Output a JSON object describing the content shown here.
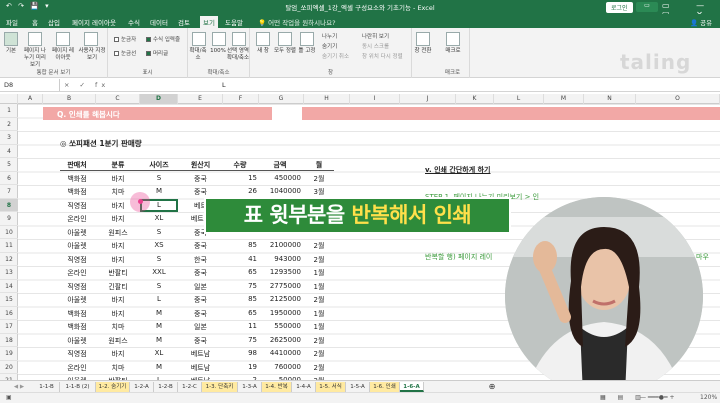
{
  "titlebar": {
    "quick_access": "↶ ↷ 💾 ▾",
    "title": "탈엄_쏘피엑셀_1강_엑셀 구성요소와 기초기능 - Excel",
    "login": "로그인",
    "window_controls": "▭ — ▢ ✕"
  },
  "ribbon_tabs": [
    "파일",
    "홈",
    "삽입",
    "페이지 레이아웃",
    "수식",
    "데이터",
    "검토",
    "보기",
    "도움말"
  ],
  "tell_me": "어떤 작업을 원하시나요?",
  "share": "공유",
  "ribbon": {
    "groups": {
      "workbook_views": "통합 문서 보기",
      "show": "표시",
      "zoom": "확대/축소",
      "window": "창",
      "macro": "매크로"
    },
    "normal": "기본",
    "page_break": "페이지 나누기 미리 보기",
    "page_layout": "페이지 레이아웃",
    "custom_views": "사용자 지정 보기",
    "ruler": "눈금자",
    "formula_bar": "수식 입력줄",
    "gridlines": "눈금선",
    "headings": "머리글",
    "zoom": "확대/축소",
    "zoom_100": "100%",
    "zoom_selection": "선택 영역 확대/축소",
    "new_window": "새 창",
    "arrange_all": "모두 정렬",
    "freeze_panes": "틀 고정",
    "split": "나누기",
    "hide": "숨기기",
    "unhide": "숨기기 취소",
    "side_by_side": "나란히 보기",
    "sync_scroll": "동시 스크롤",
    "reset_position": "창 위치 다시 정렬",
    "switch_windows": "창 전환",
    "macros": "매크로"
  },
  "brand_logo": "taling",
  "formula_bar": {
    "name_box": "D8",
    "fx": "× ✓ fx",
    "value": "L"
  },
  "columns": [
    "A",
    "B",
    "C",
    "D",
    "E",
    "F",
    "G",
    "H",
    "I",
    "J",
    "K",
    "L",
    "M",
    "N",
    "O"
  ],
  "rows": [
    "1",
    "2",
    "3",
    "4",
    "5",
    "6",
    "7",
    "8",
    "9",
    "10",
    "11",
    "12",
    "13",
    "14",
    "15",
    "16",
    "17",
    "18",
    "19",
    "20",
    "21"
  ],
  "banner_text": "Q. 인쇄를 해봅시다",
  "subtitle": "◎ 쏘피패션 1분기 판매량",
  "table": {
    "headers": [
      "판매처",
      "분류",
      "사이즈",
      "원산지",
      "수량",
      "금액",
      "월"
    ],
    "rows": [
      [
        "백화점",
        "바지",
        "S",
        "중국",
        "15",
        "450000",
        "2월"
      ],
      [
        "백화점",
        "치마",
        "M",
        "중국",
        "26",
        "1040000",
        "3월"
      ],
      [
        "직영점",
        "바지",
        "L",
        "베트",
        "21",
        "525000",
        "1월"
      ],
      [
        "온라인",
        "바지",
        "XL",
        "베트남",
        "",
        "",
        ""
      ],
      [
        "아울렛",
        "원피스",
        "S",
        "중국",
        "",
        "",
        ""
      ],
      [
        "아울렛",
        "바지",
        "XS",
        "중국",
        "85",
        "2100000",
        "2월"
      ],
      [
        "직영점",
        "바지",
        "S",
        "한국",
        "41",
        "943000",
        "2월"
      ],
      [
        "온라인",
        "반팔티",
        "XXL",
        "중국",
        "65",
        "1293500",
        "1월"
      ],
      [
        "직영점",
        "긴팔티",
        "S",
        "일본",
        "75",
        "2775000",
        "1월"
      ],
      [
        "아울렛",
        "바지",
        "L",
        "중국",
        "85",
        "2125000",
        "2월"
      ],
      [
        "백화점",
        "바지",
        "M",
        "중국",
        "65",
        "1950000",
        "1월"
      ],
      [
        "백화점",
        "치마",
        "M",
        "일본",
        "11",
        "550000",
        "1월"
      ],
      [
        "아울렛",
        "원피스",
        "M",
        "중국",
        "75",
        "2625000",
        "2월"
      ],
      [
        "직영점",
        "바지",
        "XL",
        "베트남",
        "98",
        "4410000",
        "2월"
      ],
      [
        "온라인",
        "치마",
        "M",
        "베트남",
        "19",
        "760000",
        "2월"
      ],
      [
        "아울렛",
        "반팔티",
        "L",
        "베트남",
        "2",
        "50000",
        "2월"
      ]
    ]
  },
  "right_notes": {
    "heading": "v. 인쇄 간단하게 하기",
    "step1": "STEP 1. 페이지 나누기 미리보기 > 인",
    "step2": "반복할 행) 페이지 레이",
    "tail": "마우"
  },
  "caption": {
    "part1": "표 윗부분을 ",
    "highlight": "반복해서 인쇄"
  },
  "sheet_tabs": [
    "1-1-B",
    "1-1-B (2)",
    "1-2. 숨기기",
    "1-2-A",
    "1-2-B",
    "1-2-C",
    "1-3. 단축키",
    "1-3-A",
    "1-4. 반복",
    "1-4-A",
    "1-5. 서식",
    "1-5-A",
    "1-6. 인쇄",
    "1-6-A"
  ],
  "active_sheet": "1-6-A",
  "zoom_level": "120%",
  "colors": {
    "excel_green": "#217346",
    "banner_pink": "#f2a8a6",
    "caption_green": "#2e8b3a",
    "caption_yellow": "#ffe04a",
    "note_green": "#3a9a3a",
    "sheet_tab_yellow": "#ffeaa1"
  }
}
